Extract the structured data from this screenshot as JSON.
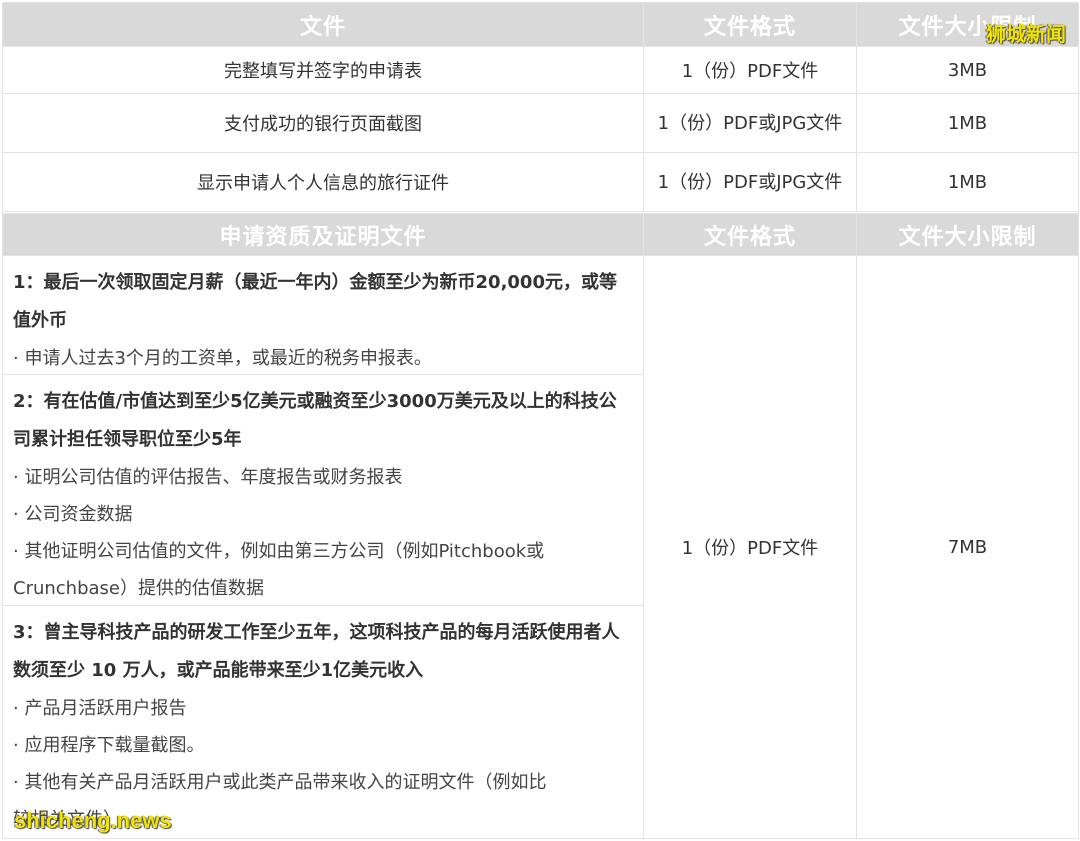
{
  "table1": {
    "headers": [
      "文件",
      "文件格式",
      "文件大小限制"
    ],
    "rows": [
      {
        "doc": "完整填写并签字的申请表",
        "format": "1（份）PDF文件",
        "size": "3MB"
      },
      {
        "doc": "支付成功的银行页面截图",
        "format": "1（份）PDF或JPG文件",
        "size": "1MB"
      },
      {
        "doc": "显示申请人个人信息的旅行证件",
        "format": "1（份）PDF或JPG文件",
        "size": "1MB"
      }
    ]
  },
  "table2": {
    "headers": [
      "申请资质及证明文件",
      "文件格式",
      "文件大小限制"
    ],
    "format": "1（份）PDF文件",
    "size": "7MB",
    "criteria": [
      {
        "title": "1：最后一次领取固定月薪（最近一年内）金额至少为新币20,000元，或等值外币",
        "items": [
          "· 申请人过去3个月的工资单，或最近的税务申报表。"
        ]
      },
      {
        "title": "2：有在估值/市值达到至少5亿美元或融资至少3000万美元及以上的科技公司累计担任领导职位至少5年",
        "items": [
          "· 证明公司估值的评估报告、年度报告或财务报表",
          "· 公司资金数据",
          "· 其他证明公司估值的文件，例如由第三方公司（例如Pitchbook或Crunchbase）提供的估值数据"
        ]
      },
      {
        "title": "3：曾主导科技产品的研发工作至少五年，这项科技产品的每月活跃使用者人数须至少 10 万人，或产品能带来至少1亿美元收入",
        "items": [
          "· 产品月活跃用户报告",
          "· 应用程序下载量截图。",
          "· 其他有关产品月活跃用户或此类产品带来收入的证明文件（例如比\n较相关文件）"
        ]
      }
    ]
  },
  "watermark": {
    "top": "狮城新闻",
    "bottom": "shicheng.news"
  }
}
